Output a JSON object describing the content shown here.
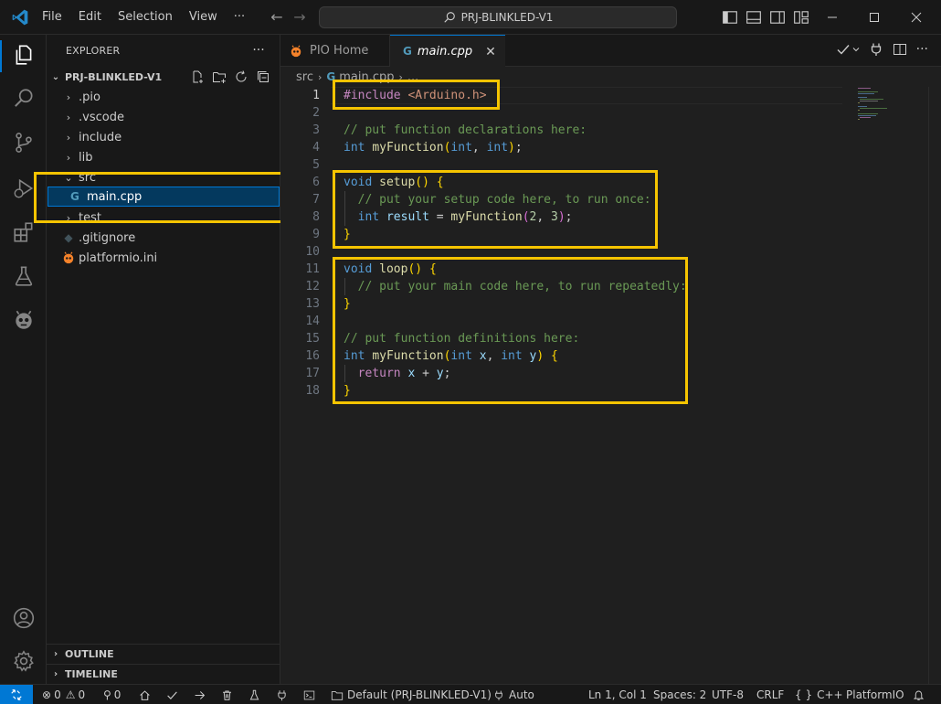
{
  "menu": [
    "File",
    "Edit",
    "Selection",
    "View",
    "···"
  ],
  "command_center": "PRJ-BLINKLED-V1",
  "sidebar": {
    "title": "EXPLORER",
    "more": "···",
    "folder": "PRJ-BLINKLED-V1",
    "items": [
      {
        "label": ".pio",
        "type": "folder",
        "state": "collapsed"
      },
      {
        "label": ".vscode",
        "type": "folder",
        "state": "collapsed"
      },
      {
        "label": "include",
        "type": "folder",
        "state": "collapsed"
      },
      {
        "label": "lib",
        "type": "folder",
        "state": "collapsed"
      },
      {
        "label": "src",
        "type": "folder",
        "state": "expanded"
      },
      {
        "label": "main.cpp",
        "type": "file",
        "icon": "cpp-icon",
        "selected": true
      },
      {
        "label": "test",
        "type": "folder",
        "state": "collapsed"
      },
      {
        "label": ".gitignore",
        "type": "file",
        "icon": "git-icon"
      },
      {
        "label": "platformio.ini",
        "type": "file",
        "icon": "platformio-icon"
      }
    ],
    "outline": "OUTLINE",
    "timeline": "TIMELINE"
  },
  "tabs": [
    {
      "label": "PIO Home",
      "active": false
    },
    {
      "label": "main.cpp",
      "active": true
    }
  ],
  "breadcrumb": [
    "src",
    "main.cpp",
    "..."
  ],
  "editor": {
    "line_numbers": [
      "1",
      "2",
      "3",
      "4",
      "5",
      "6",
      "7",
      "8",
      "9",
      "10",
      "11",
      "12",
      "13",
      "14",
      "15",
      "16",
      "17",
      "18"
    ],
    "current_line": "1"
  },
  "statusbar": {
    "errors": "0",
    "warnings": "0",
    "ports": "0",
    "env": "Default (PRJ-BLINKLED-V1)",
    "auto": "Auto",
    "position": "Ln 1, Col 1",
    "spaces": "Spaces: 2",
    "encoding": "UTF-8",
    "eol": "CRLF",
    "language": "C++",
    "language_icon": "{ }",
    "platform": "PlatformIO"
  },
  "colors": {
    "accent": "#0078d4",
    "highlight_box": "#f5c400",
    "selection": "#04395e"
  }
}
